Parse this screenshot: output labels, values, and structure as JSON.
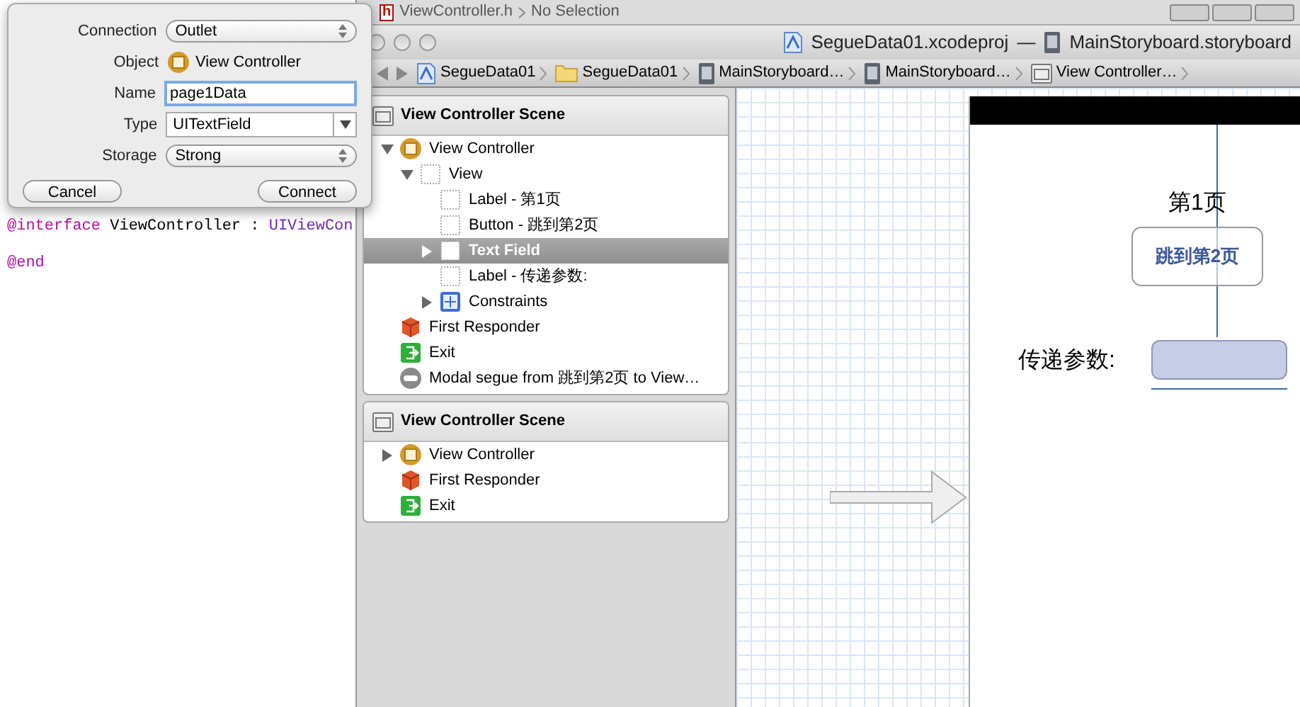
{
  "background_tab": {
    "badge": "h",
    "file": "ViewController.h",
    "path": "No Selection"
  },
  "view_toggles": [
    {
      "selected": false
    },
    {
      "selected": false
    },
    {
      "selected": false
    }
  ],
  "window": {
    "project": "SegueData01.xcodeproj",
    "separator": "—",
    "file": "MainStoryboard.storyboard"
  },
  "breadcrumbs": [
    {
      "label": "SegueData01",
      "kind": "project"
    },
    {
      "label": "SegueData01",
      "kind": "folder"
    },
    {
      "label": "MainStoryboard…",
      "kind": "storyboard"
    },
    {
      "label": "MainStoryboard…",
      "kind": "storyboard"
    },
    {
      "label": "View Controller…",
      "kind": "scene"
    }
  ],
  "popover": {
    "rows": [
      {
        "label": "Connection",
        "kind": "popup",
        "value": "Outlet"
      },
      {
        "label": "Object",
        "kind": "object",
        "value": "View Controller"
      },
      {
        "label": "Name",
        "kind": "input",
        "value": "page1Data"
      },
      {
        "label": "Type",
        "kind": "combo",
        "value": "UITextField"
      },
      {
        "label": "Storage",
        "kind": "popup",
        "value": "Strong"
      }
    ],
    "buttons": [
      "Cancel",
      "Connect"
    ]
  },
  "code": [
    [
      {
        "kind": "keyword",
        "text": "@interface"
      },
      {
        "kind": "plain",
        "text": " ViewController : "
      },
      {
        "kind": "type",
        "text": "UIViewCon"
      }
    ],
    [
      {
        "kind": "keyword",
        "text": "@end"
      }
    ]
  ],
  "scenes": [
    {
      "title": "View Controller Scene",
      "items": [
        {
          "label": "View Controller",
          "kind": "controller",
          "expanded": true,
          "selected": false,
          "children": [
            {
              "label": "View",
              "kind": "view",
              "expanded": true,
              "selected": false,
              "children": [
                {
                  "label": "Label - 第1页",
                  "kind": "view",
                  "selected": false
                },
                {
                  "label": "Button - 跳到第2页",
                  "kind": "view",
                  "selected": false
                },
                {
                  "label": "Text Field",
                  "kind": "view",
                  "expanded": false,
                  "selected": true
                },
                {
                  "label": "Label - 传递参数:",
                  "kind": "view",
                  "selected": false
                },
                {
                  "label": "Constraints",
                  "kind": "constraints",
                  "expanded": false,
                  "selected": false
                }
              ]
            }
          ]
        },
        {
          "label": "First Responder",
          "kind": "responder",
          "selected": false
        },
        {
          "label": "Exit",
          "kind": "exit",
          "selected": false
        },
        {
          "label": "Modal segue from 跳到第2页 to View…",
          "kind": "segue",
          "selected": false
        }
      ]
    },
    {
      "title": "View Controller Scene",
      "items": [
        {
          "label": "View Controller",
          "kind": "controller",
          "expanded": false,
          "selected": false
        },
        {
          "label": "First Responder",
          "kind": "responder",
          "selected": false
        },
        {
          "label": "Exit",
          "kind": "exit",
          "selected": false
        }
      ]
    }
  ],
  "canvas": {
    "title_label": "第1页",
    "button": "跳到第2页",
    "field_label": "传递参数:"
  }
}
